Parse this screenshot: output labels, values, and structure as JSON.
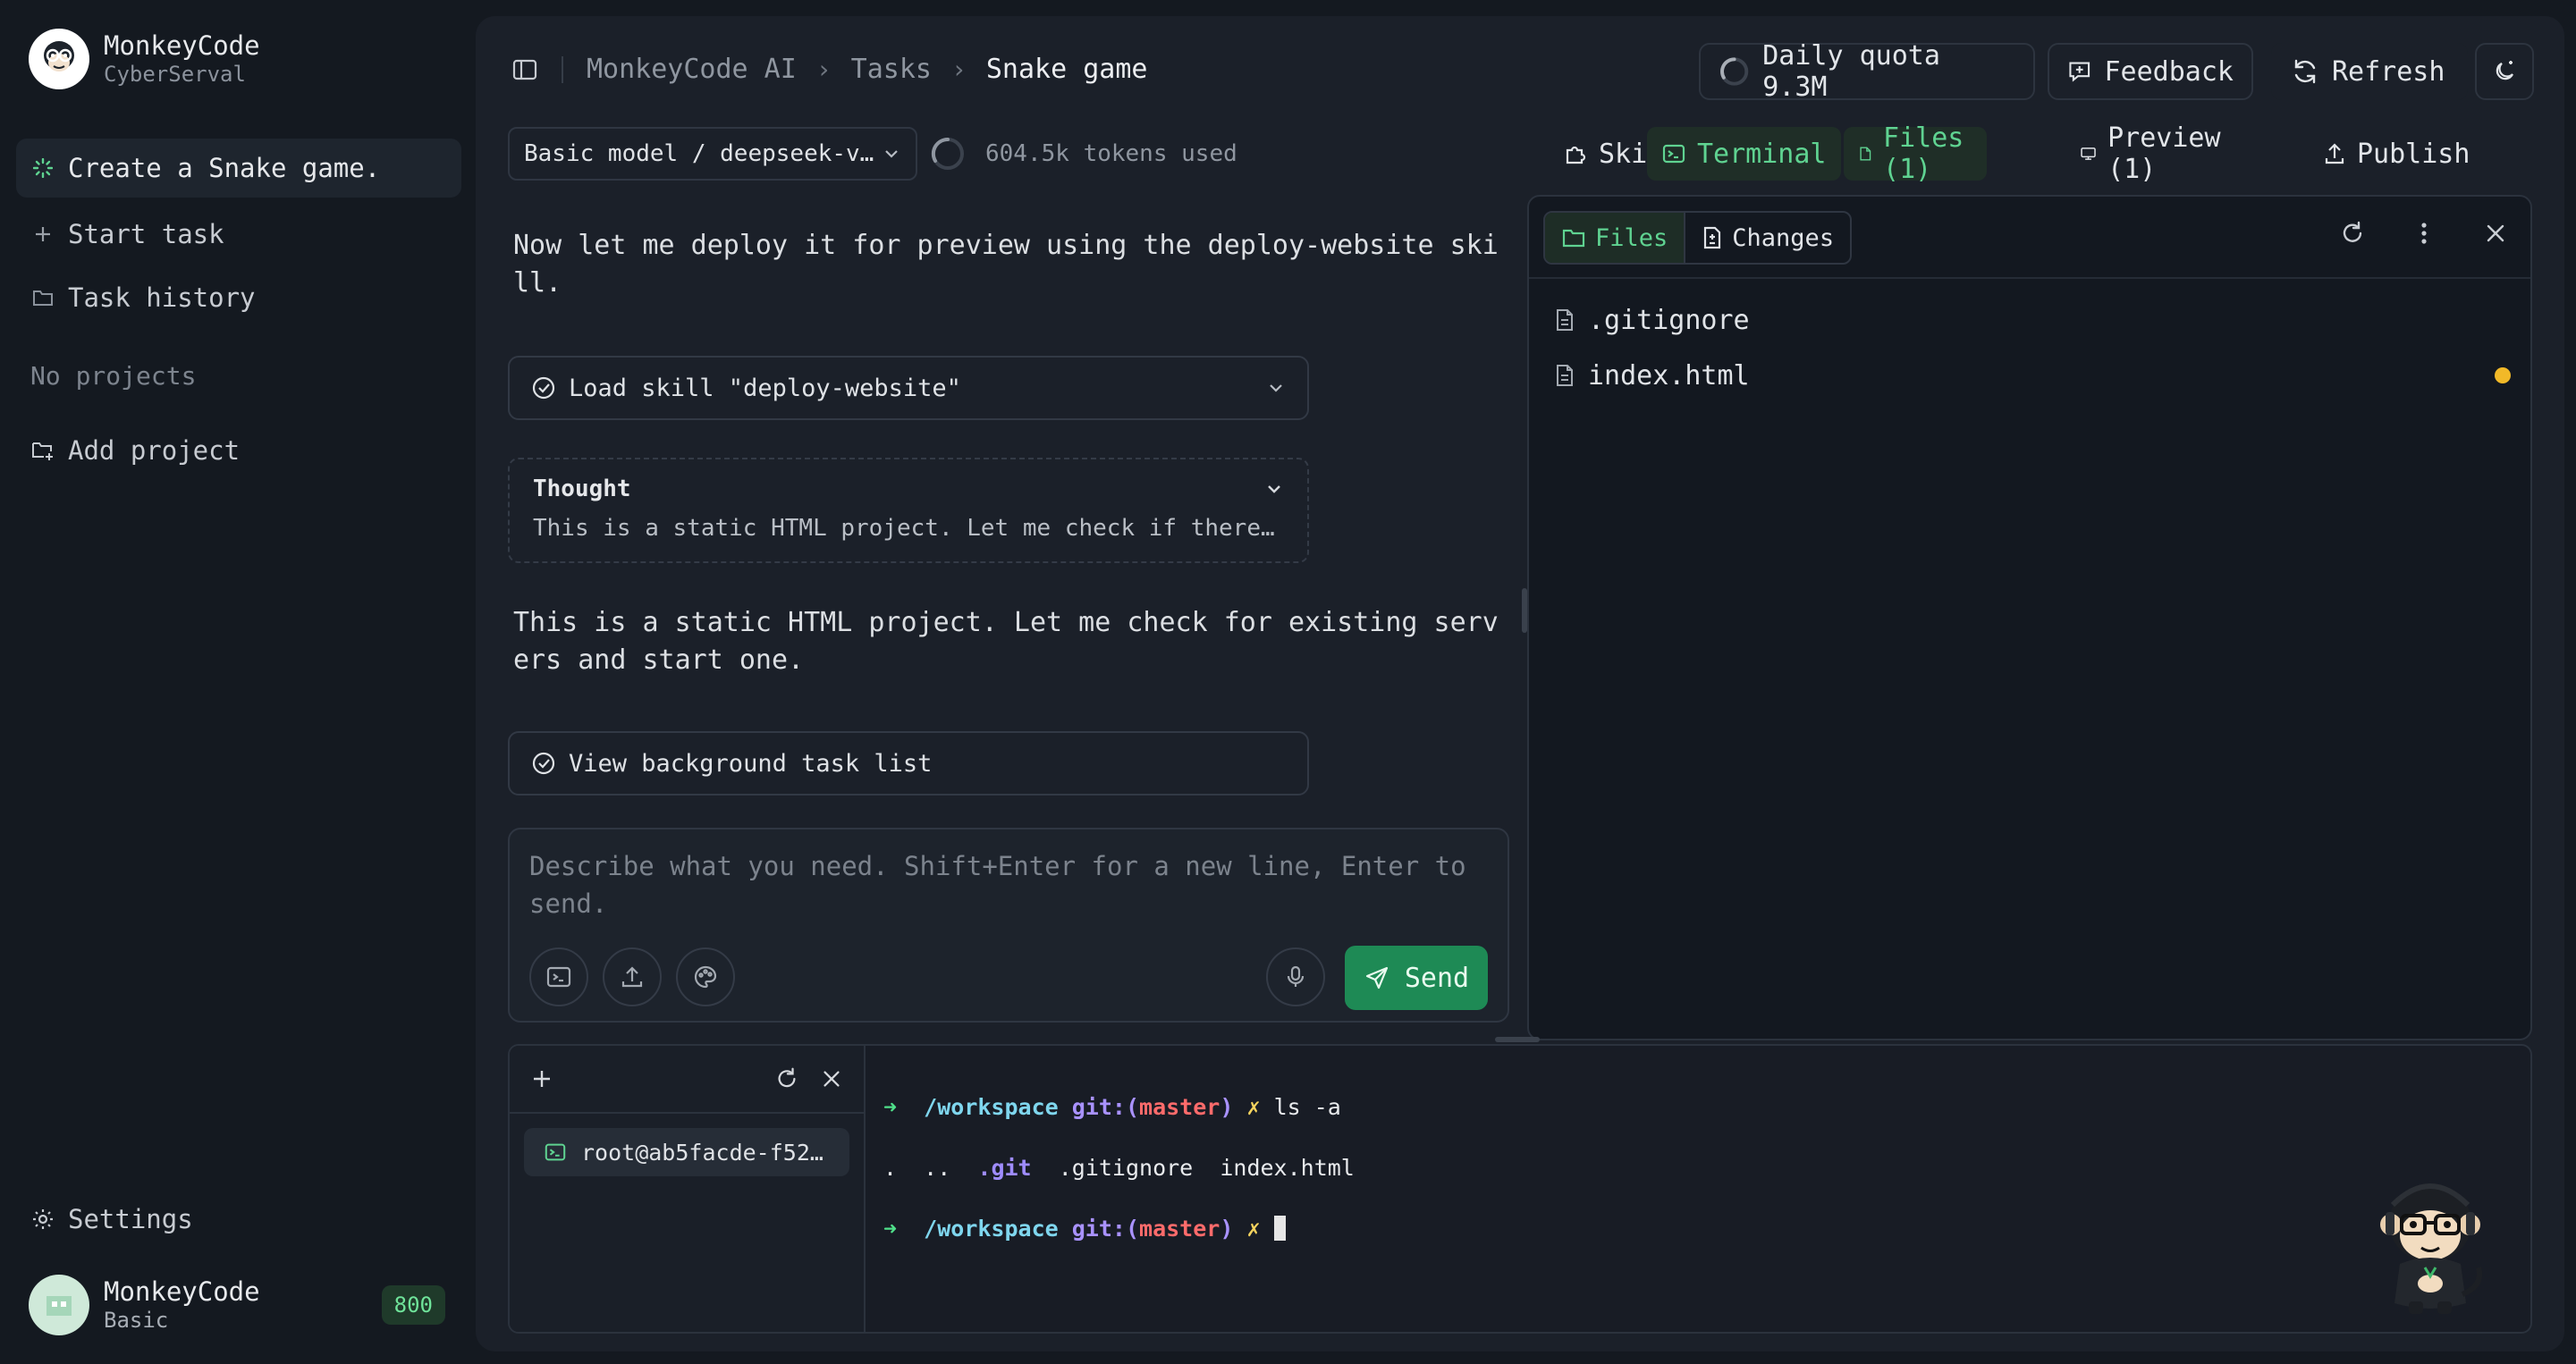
{
  "brand": {
    "name": "MonkeyCode",
    "org": "CyberServal"
  },
  "sidebar": {
    "current_task": "Create a Snake game.",
    "start_task": "Start task",
    "task_history": "Task history",
    "no_projects": "No projects",
    "add_project": "Add project",
    "settings": "Settings"
  },
  "user": {
    "name": "MonkeyCode",
    "plan": "Basic",
    "credits": "800"
  },
  "breadcrumb": {
    "root": "MonkeyCode AI",
    "section": "Tasks",
    "current": "Snake game"
  },
  "topbar": {
    "quota": "Daily quota 9.3M",
    "feedback": "Feedback",
    "refresh": "Refresh"
  },
  "model": {
    "selected": "Basic model / deepseek-v…",
    "tokens_used": "604.5k tokens used"
  },
  "chat": {
    "msg1": "Now let me deploy it for preview using the deploy-website skill.",
    "tool1": "Load skill \"deploy-website\"",
    "thought_title": "Thought",
    "thought_body": "This is a static HTML project. Let me check if there's …",
    "msg2": "This is a static HTML project. Let me check for existing servers and start one.",
    "tool2": "View background task list"
  },
  "composer": {
    "placeholder": "Describe what you need. Shift+Enter for a new line, Enter to send.",
    "send": "Send"
  },
  "right_tabs": {
    "skills": "Skills",
    "terminal": "Terminal",
    "files": "Files (1)",
    "preview": "Preview (1)",
    "publish": "Publish"
  },
  "files_panel": {
    "tab_files": "Files",
    "tab_changes": "Changes",
    "files": [
      ".gitignore",
      "index.html"
    ],
    "modified_color": "#f2b928"
  },
  "terminal": {
    "session": "root@ab5facde-f52…",
    "path": "/workspace",
    "git_label": "git:(",
    "branch": "master",
    "git_close": ")",
    "dirty_mark": "✗",
    "command": "ls -a",
    "entries": [
      ".",
      "..",
      ".git",
      ".gitignore",
      "index.html"
    ]
  },
  "colors": {
    "accent_green": "#1e8a55",
    "green_text": "#5fd391",
    "background": "#141920",
    "panel": "#1b2029"
  }
}
